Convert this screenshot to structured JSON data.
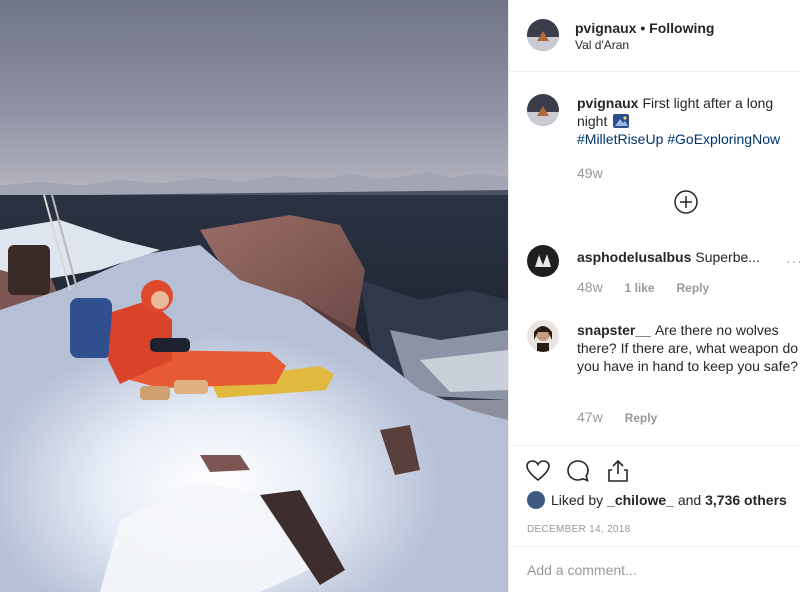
{
  "post": {
    "username": "pvignaux",
    "separator": "•",
    "follow_status": "Following",
    "location": "Val d'Aran"
  },
  "caption": {
    "username": "pvignaux",
    "text": "First light after a long night",
    "emoji_icon": "mountain-sunrise-icon",
    "hashtags": [
      "#MilletRiseUp",
      "#GoExploringNow"
    ],
    "time": "49w"
  },
  "load_more_icon": "plus-circle-icon",
  "comments": [
    {
      "username": "asphodelusalbus",
      "text": "Superbe...",
      "time": "48w",
      "likes": "1 like",
      "reply": "Reply"
    },
    {
      "username": "snapster__",
      "text": "Are there no wolves there? If there are, what weapon do you have in hand to keep you safe?",
      "time": "47w",
      "reply": "Reply"
    }
  ],
  "actions": {
    "like_icon": "heart-icon",
    "comment_icon": "comment-icon",
    "share_icon": "share-icon"
  },
  "likes": {
    "prefix": "Liked by",
    "user": "_chilowe_",
    "middle": "and",
    "count": "3,736 others"
  },
  "date": "DECEMBER 14, 2018",
  "comment_box": {
    "placeholder": "Add a comment..."
  }
}
